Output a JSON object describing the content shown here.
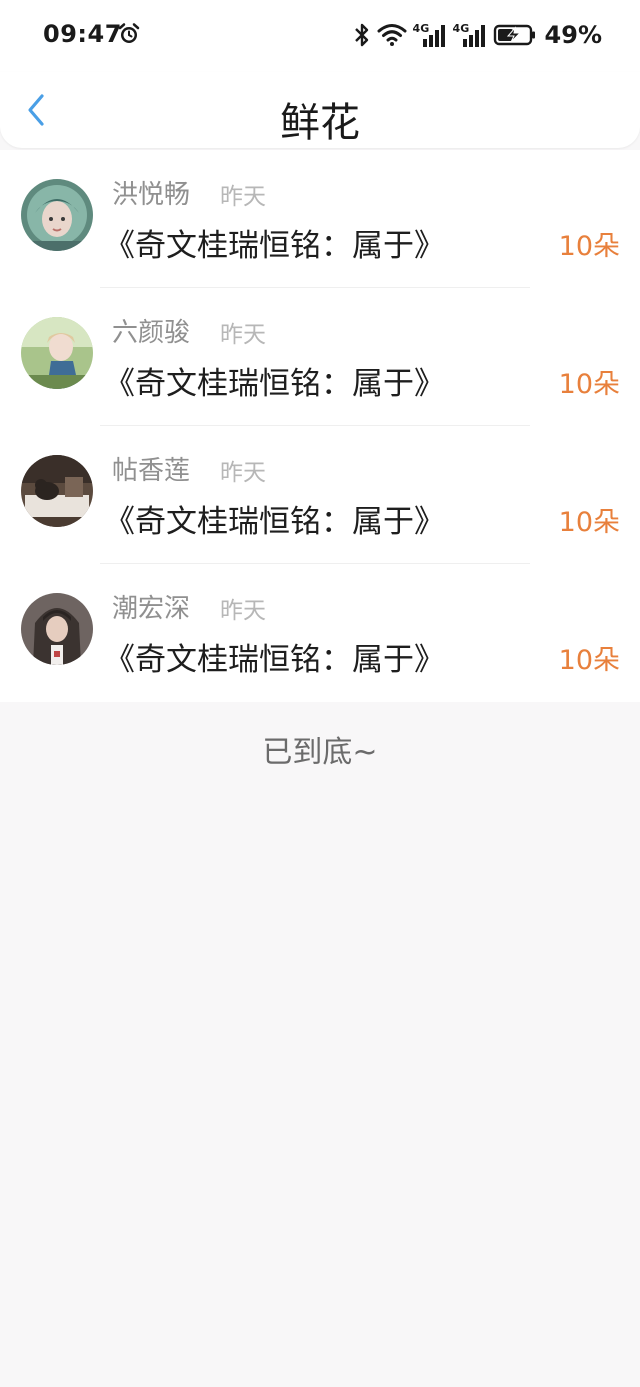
{
  "status_bar": {
    "time": "09:47",
    "battery": "49%",
    "network_1": "4G",
    "network_2": "4G"
  },
  "header": {
    "title": "鲜花"
  },
  "items": [
    {
      "name": "洪悦畅",
      "time": "昨天",
      "title": "《奇文桂瑞恒铭：属于》",
      "count": "10朵"
    },
    {
      "name": "六颜骏",
      "time": "昨天",
      "title": "《奇文桂瑞恒铭：属于》",
      "count": "10朵"
    },
    {
      "name": "帖香莲",
      "time": "昨天",
      "title": "《奇文桂瑞恒铭：属于》",
      "count": "10朵"
    },
    {
      "name": "潮宏深",
      "time": "昨天",
      "title": "《奇文桂瑞恒铭：属于》",
      "count": "10朵"
    }
  ],
  "footer": {
    "end_text": "已到底~"
  },
  "colors": {
    "accent_blue": "#4a9fe6",
    "count_orange": "#e8803c",
    "background": "#f8f7f8"
  },
  "icons": {
    "back": "chevron-left-icon",
    "alarm": "alarm-clock-icon",
    "bluetooth": "bluetooth-icon",
    "wifi": "wifi-icon",
    "signal": "signal-icon",
    "battery": "battery-charging-icon"
  }
}
